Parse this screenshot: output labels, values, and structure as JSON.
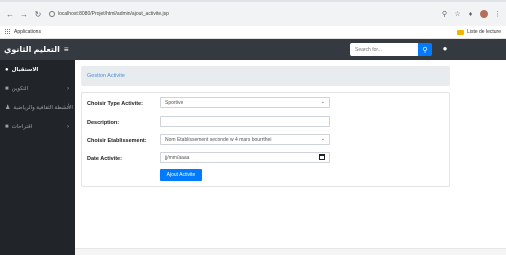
{
  "browser": {
    "url": "localhost:8080/Projet/html/admin/ajout_activite.jsp",
    "bookmark_apps": "Applications",
    "bookmark_right": "Liste de lecture"
  },
  "navbar": {
    "brand": "التعليم الثانوي",
    "menu_icon": "menu-icon",
    "search_placeholder": "Search for...",
    "search_icon": "search-icon",
    "user_icon": "user-icon"
  },
  "sidebar": {
    "items": [
      {
        "label": "الاستقبال",
        "icon": "dashboard-icon",
        "active": true
      },
      {
        "label": "التكوين",
        "icon": "folder-icon",
        "active": false
      },
      {
        "label": "الأنشطة الثقافية والرياضية",
        "icon": "user-icon",
        "active": false
      },
      {
        "label": "اقتراحات",
        "icon": "folder-icon",
        "active": false
      }
    ]
  },
  "breadcrumb": {
    "label": "Gestion Activite"
  },
  "form": {
    "type_label": "Choisir Type Activite:",
    "type_value": "Sportive",
    "description_label": "Description:",
    "description_value": "",
    "etab_label": "Choisir Etablissement:",
    "etab_value": "Nom Etablissement seconde w 4 mars bourrthei",
    "date_label": "Date Activite:",
    "date_placeholder": "jj/mm/aaaa",
    "submit_label": "Ajout Activite"
  }
}
